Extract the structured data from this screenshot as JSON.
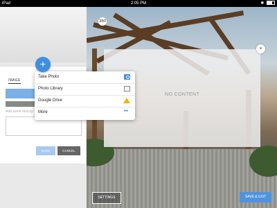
{
  "statusbar": {
    "device": "iPad",
    "time": "2:05 PM"
  },
  "editor": {
    "tabs": [
      "IMAGE",
      ""
    ],
    "description_placeholder": "Add some descrip",
    "save_label": "SAVE",
    "cancel_label": "CANCEL"
  },
  "popover": {
    "items": [
      {
        "label": "Take Photo",
        "icon": "camera-icon"
      },
      {
        "label": "Photo Library",
        "icon": "photo-library-icon"
      },
      {
        "label": "Google Drive",
        "icon": "google-drive-icon"
      },
      {
        "label": "More",
        "icon": "more-icon"
      }
    ]
  },
  "viewer": {
    "no_content": "NO CONTENT",
    "badge": "360",
    "settings_label": "SETTINGS",
    "save_exit_label": "SAVE & EXIT",
    "close_glyph": "×"
  },
  "fab_glyph": "+",
  "colors": {
    "accent": "#3f8fe0",
    "save_exit": "#4e93e0",
    "save_disabled": "#a9c9ef"
  }
}
